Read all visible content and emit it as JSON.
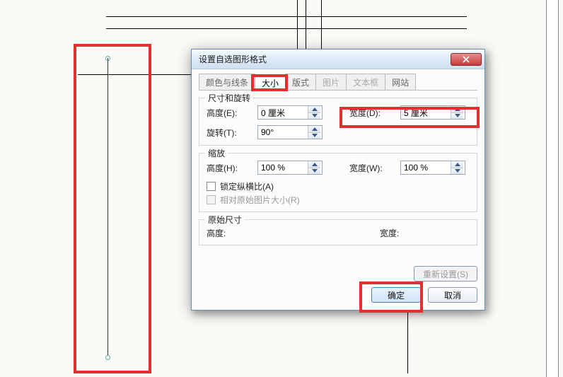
{
  "dialog": {
    "title": "设置自选图形格式",
    "tabs": {
      "colors_lines": "颜色与线条",
      "size": "大小",
      "layout": "版式",
      "picture": "图片",
      "textbox": "文本框",
      "web": "网站"
    },
    "group_size_rotation_title": "尺寸和旋转",
    "height_label": "高度(E):",
    "height_value": "0 厘米",
    "width_label": "宽度(D):",
    "width_value": "5 厘米",
    "rotation_label": "旋转(T):",
    "rotation_value": "90°",
    "group_scale_title": "缩放",
    "scale_height_label": "高度(H):",
    "scale_height_value": "100 %",
    "scale_width_label": "宽度(W):",
    "scale_width_value": "100 %",
    "lock_aspect_label": "锁定纵横比(A)",
    "relative_original_label": "相对原始图片大小(R)",
    "group_original_title": "原始尺寸",
    "orig_height_label": "高度:",
    "orig_width_label": "宽度:",
    "reset_btn": "重新设置(S)",
    "ok_btn": "确定",
    "cancel_btn": "取消"
  }
}
